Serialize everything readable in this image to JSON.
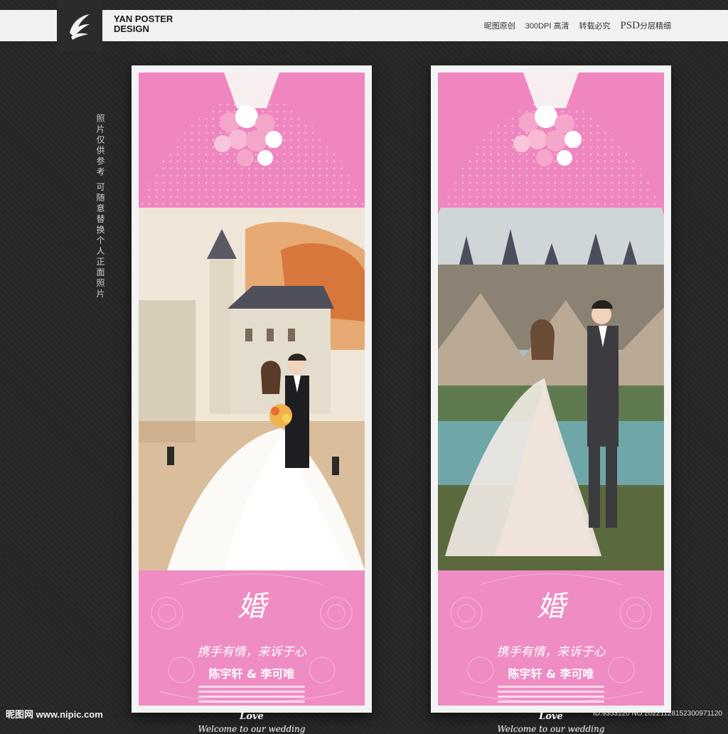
{
  "header": {
    "brand_line1": "YAN POSTER",
    "brand_line2": "DESIGN",
    "brand_sub": "",
    "nav": [
      "昵图原创",
      "300DPI 高清",
      "转载必究"
    ],
    "psd_label": "PSD",
    "psd_suffix": "分层精细"
  },
  "side_note": "照片仅供参考 可随意替换个人正面照片",
  "posters": [
    {
      "hun_char": "婚",
      "slogan": "携手有情，来诉于心",
      "names": "陈宇轩 & 李可唯",
      "love": "Love",
      "welcome": "Welcome to our wedding"
    },
    {
      "hun_char": "婚",
      "slogan": "携手有情，来诉于心",
      "names": "陈宇轩 & 李可唯",
      "love": "Love",
      "welcome": "Welcome to our wedding"
    }
  ],
  "footer": {
    "left": "昵图网 www.nipic.com",
    "right": "ID:9353120 NO:20221128152300971120"
  },
  "colors": {
    "pink": "#ef86bf",
    "bottom_pink": "#ee8cc3"
  }
}
